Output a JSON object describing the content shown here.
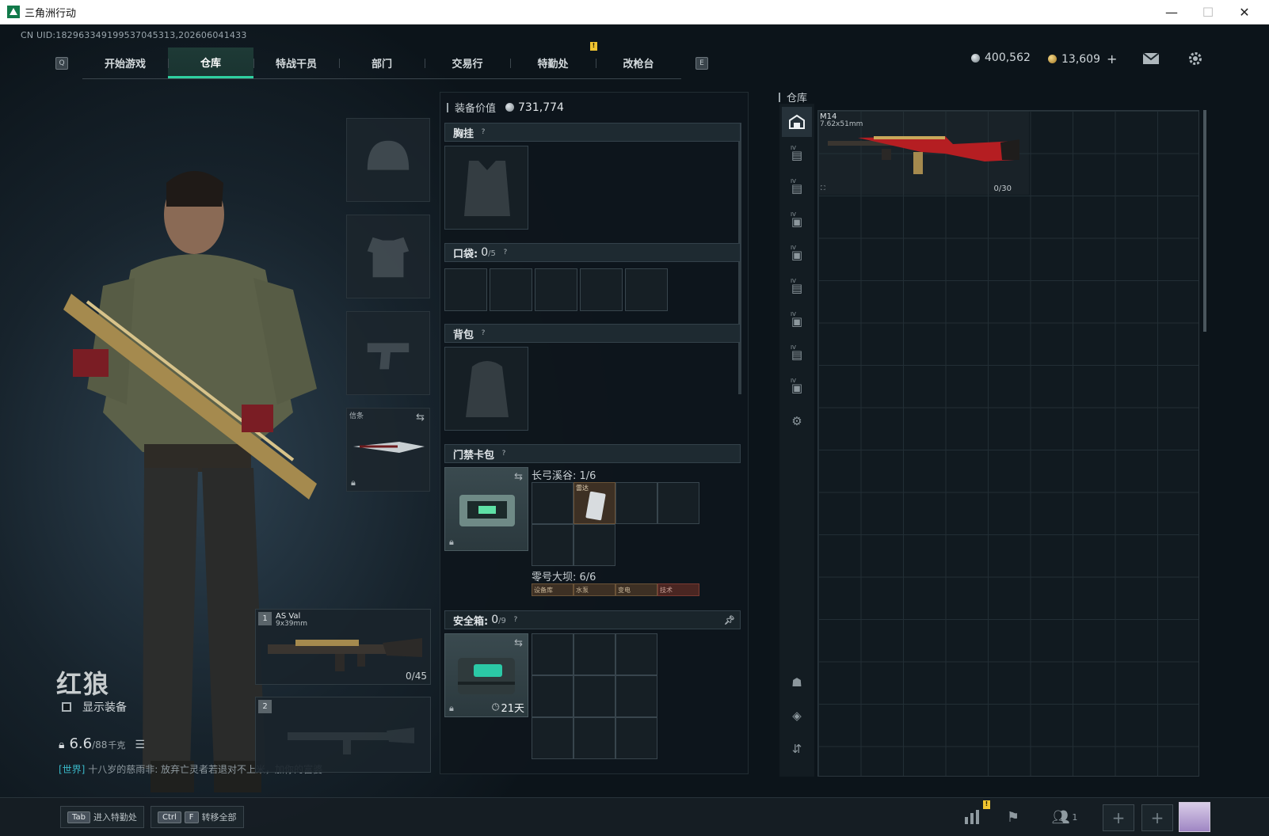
{
  "window": {
    "title": "三角洲行动",
    "minimize": "—",
    "maximize": "☐",
    "close": "✕"
  },
  "uid": "CN UID:182963349199537045313,202606041433",
  "nav": {
    "left_key": "Q",
    "right_key": "E",
    "tabs": [
      {
        "label": "开始游戏"
      },
      {
        "label": "仓库",
        "active": true
      },
      {
        "label": "特战干员"
      },
      {
        "label": "部门"
      },
      {
        "label": "交易行"
      },
      {
        "label": "特勤处"
      },
      {
        "label": "改枪台"
      }
    ],
    "badge": "!"
  },
  "currency": {
    "silver": "400,562",
    "gold": "13,609",
    "gold_add": "+"
  },
  "operator": {
    "name": "红狼",
    "show_equipment": "显示装备",
    "weight_current": "6.6",
    "weight_max": "/88",
    "weight_unit": "千克"
  },
  "chat": {
    "channel": "[世界]",
    "message": "十八岁的慈雨非: 放弃亡灵者若退对不上米，加你的富婆"
  },
  "equipment_slots": {
    "melee_label": "信条",
    "primary": {
      "num": "1",
      "name": "AS Val",
      "caliber": "9x39mm",
      "ammo": "0/45"
    },
    "secondary": {
      "num": "2"
    }
  },
  "gear": {
    "value_label": "装备价值",
    "value": "731,774",
    "chest_rig": "胸挂",
    "pocket_label": "口袋:",
    "pocket_count": "0",
    "pocket_max": "/5",
    "backpack": "背包",
    "keycard": "门禁卡包",
    "keycard_zone1": "长弓溪谷: 1/6",
    "keycard_zone1_item": "雷达",
    "keycard_zone2": "零号大坝: 6/6",
    "keycard_zone2_items": [
      "设备库",
      "水泵",
      "变电",
      "技术"
    ],
    "safe_box_label": "安全箱:",
    "safe_box_count": "0",
    "safe_box_max": "/9",
    "safe_box_timer": "21天",
    "help": "?"
  },
  "stash": {
    "title": "仓库",
    "item": {
      "name": "M14",
      "caliber": "7.62x51mm",
      "ammo": "0/30"
    },
    "side_tab_level": "IV"
  },
  "bottom": {
    "hint1_key": "Tab",
    "hint1_label": "进入特勤处",
    "hint2_key1": "Ctrl",
    "hint2_key2": "F",
    "hint2_label": "转移全部",
    "squad_count": "1"
  },
  "colors": {
    "accent": "#2fd0a0",
    "badge": "#f0c430",
    "danger_red": "#b51e22"
  }
}
